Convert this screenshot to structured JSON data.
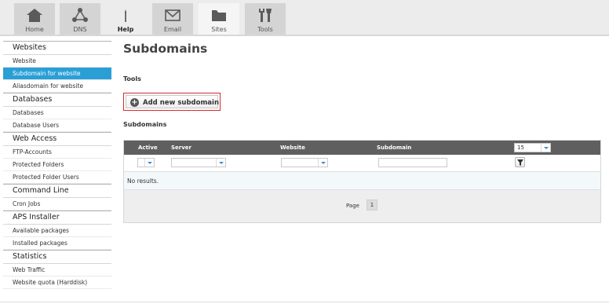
{
  "nav": {
    "tabs": [
      {
        "label": "Home",
        "icon": "home-icon"
      },
      {
        "label": "DNS",
        "icon": "dns-network-icon"
      },
      {
        "label": "Help",
        "icon": "help-icon"
      },
      {
        "label": "Email",
        "icon": "envelope-icon"
      },
      {
        "label": "Sites",
        "icon": "folder-icon",
        "active": true
      },
      {
        "label": "Tools",
        "icon": "tools-icon"
      }
    ]
  },
  "sidebar": {
    "sections": [
      {
        "title": "Websites",
        "items": [
          "Website",
          "Subdomain for website",
          "Aliasdomain for website"
        ]
      },
      {
        "title": "Databases",
        "items": [
          "Databases",
          "Database Users"
        ]
      },
      {
        "title": "Web Access",
        "items": [
          "FTP-Accounts",
          "Protected Folders",
          "Protected Folder Users"
        ]
      },
      {
        "title": "Command Line",
        "items": [
          "Cron Jobs"
        ]
      },
      {
        "title": "APS Installer",
        "items": [
          "Available packages",
          "Installed packages"
        ]
      },
      {
        "title": "Statistics",
        "items": [
          "Web Traffic",
          "Website quota (Harddisk)"
        ]
      }
    ],
    "active_item": "Subdomain for website"
  },
  "main": {
    "title": "Subdomains",
    "tools_label": "Tools",
    "add_button": "Add new subdomain",
    "list_label": "Subdomains"
  },
  "grid": {
    "columns": [
      "Active",
      "Server",
      "Website",
      "Subdomain"
    ],
    "per_page": "15",
    "empty_text": "No results.",
    "page_label": "Page",
    "current_page": "1"
  },
  "colors": {
    "accent": "#2a9fd6",
    "header_bg": "#5f5f5f",
    "highlight_border": "#d92b2b"
  }
}
